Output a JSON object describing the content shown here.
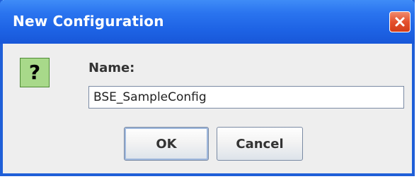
{
  "dialog": {
    "title": "New Configuration",
    "close_icon": "close-icon",
    "prompt_icon": "question-icon",
    "prompt_icon_glyph": "?",
    "name_label": "Name:",
    "name_value": "BSE_SampleConfig",
    "buttons": {
      "ok_label": "OK",
      "cancel_label": "Cancel"
    }
  },
  "colors": {
    "titlebar": "#2a74ef",
    "close_button": "#e4512e",
    "icon_background": "#a8d98a",
    "dialog_background": "#eeeeee"
  }
}
